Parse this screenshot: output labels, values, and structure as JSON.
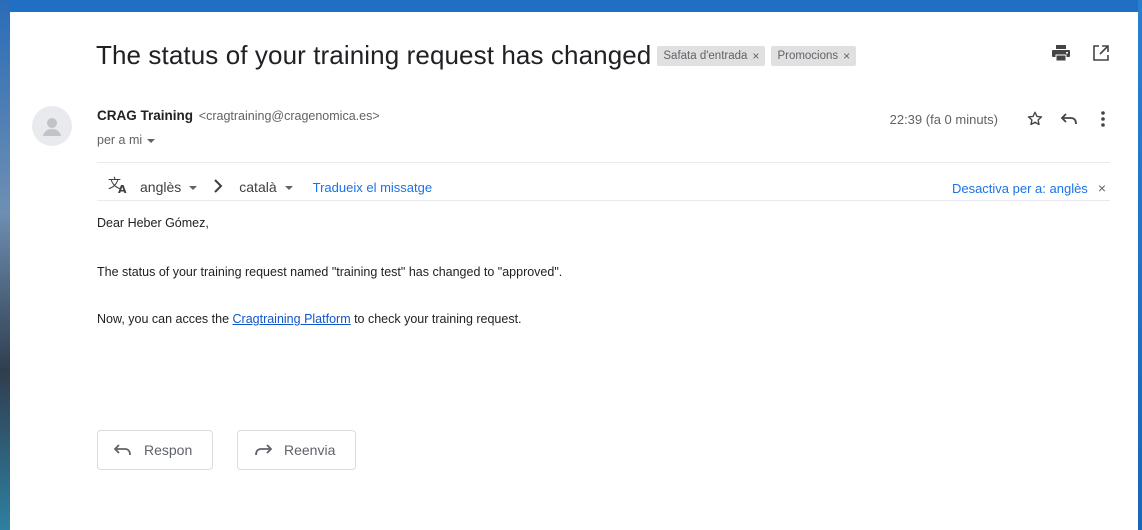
{
  "email": {
    "subject": "The status of your training request has changed",
    "labels": [
      {
        "name": "Safata d'entrada",
        "close": "×"
      },
      {
        "name": "Promocions",
        "close": "×"
      }
    ],
    "sender_name": "CRAG Training",
    "sender_email": "<cragtraining@cragenomica.es>",
    "to_line": "per a mi",
    "time": "22:39 (fa 0 minuts)"
  },
  "translate": {
    "source_lang": "anglès",
    "target_lang": "català",
    "translate_link": "Tradueix el missatge",
    "turn_off": "Desactiva per a: anglès",
    "turn_off_close": "×"
  },
  "body": {
    "greeting": "Dear Heber Gómez,",
    "line1": "The status of your training request named \"training test\" has changed to \"approved\".",
    "line2_prefix": "Now, you can acces the ",
    "line2_link": "Cragtraining Platform",
    "line2_suffix": " to check your training request."
  },
  "actions": {
    "reply": "Respon",
    "forward": "Reenvia"
  },
  "icons": {
    "print": "print-icon",
    "open_new_window": "open-in-new-window-icon",
    "star": "star-icon",
    "reply": "reply-icon",
    "more": "more-vert-icon",
    "translate": "translate-icon"
  },
  "colors": {
    "link": "#1a73e8",
    "chip_bg": "#e0e0e0",
    "text": "#202124",
    "muted": "#5f6368"
  }
}
